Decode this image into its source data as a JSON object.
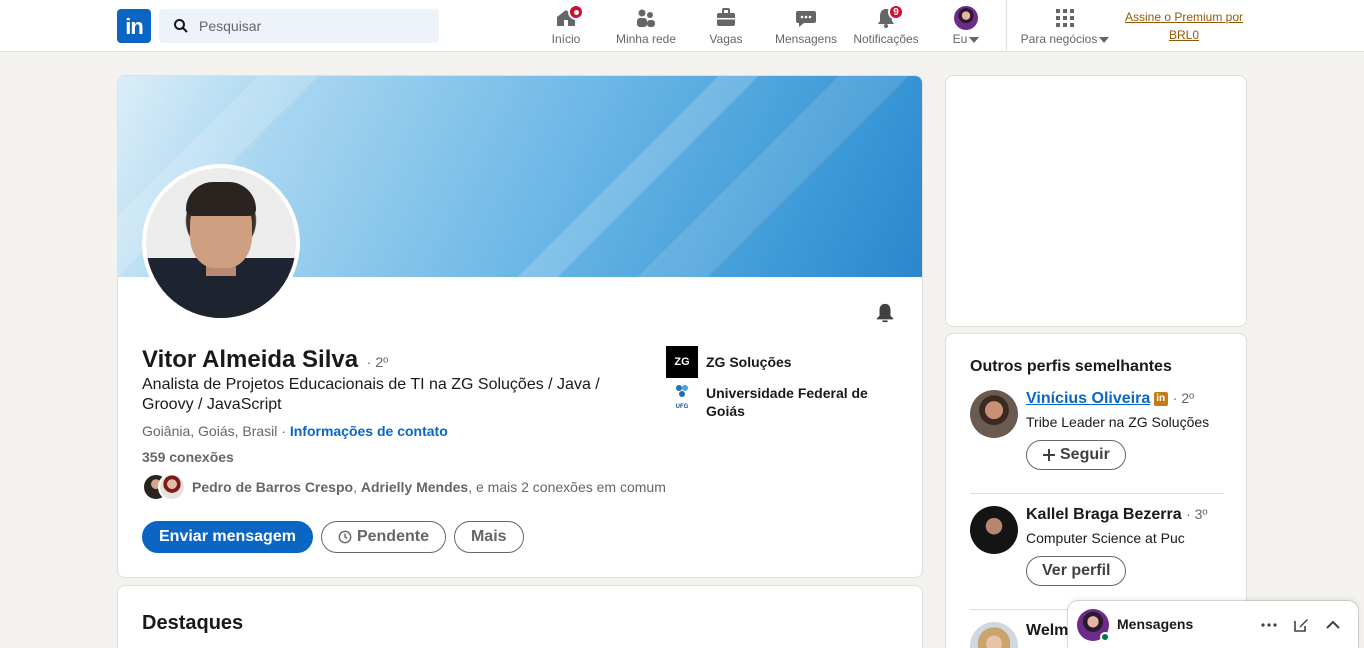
{
  "nav": {
    "search_placeholder": "Pesquisar",
    "items": [
      {
        "label": "Início",
        "icon": "home-icon",
        "badge": "dot"
      },
      {
        "label": "Minha rede",
        "icon": "network-icon"
      },
      {
        "label": "Vagas",
        "icon": "briefcase-icon"
      },
      {
        "label": "Mensagens",
        "icon": "messaging-icon"
      },
      {
        "label": "Notificações",
        "icon": "bell-icon",
        "badge": "9"
      },
      {
        "label": "Eu",
        "icon": "avatar"
      },
      {
        "label": "Para negócios",
        "icon": "grid-icon"
      }
    ],
    "premium": "Assine o Premium por BRL0"
  },
  "profile": {
    "name": "Vitor Almeida Silva",
    "degree": "· 2º",
    "headline": "Analista de Projetos Educacionais de TI na ZG Soluções / Java / Groovy / JavaScript",
    "location": "Goiânia, Goiás, Brasil ·",
    "contact_link": "Informações de contato",
    "connections": "359 conexões",
    "mutual_names": [
      "Pedro de Barros Crespo",
      "Adrielly Mendes"
    ],
    "mutual_sep": ",",
    "mutual_rest": ", e mais 2 conexões em comum",
    "buttons": {
      "message": "Enviar mensagem",
      "pending": "Pendente",
      "more": "Mais"
    },
    "orgs": [
      {
        "name": "ZG Soluções",
        "logo_text": "ZG"
      },
      {
        "name": "Universidade Federal de Goiás",
        "logo_text": "UFG"
      }
    ]
  },
  "highlights": {
    "title": "Destaques"
  },
  "similar": {
    "title": "Outros perfis semelhantes",
    "people": [
      {
        "name": "Vinícius Oliveira",
        "degree": "· 2º",
        "headline": "Tribe Leader na ZG Soluções",
        "action": "Seguir"
      },
      {
        "name": "Kallel Braga Bezerra",
        "degree": "· 3º",
        "headline": "Computer Science at Puc",
        "action": "Ver perfil"
      },
      {
        "name": "Welma"
      }
    ]
  },
  "messaging": {
    "title": "Mensagens"
  },
  "colors": {
    "brand": "#0a66c2",
    "badge": "#cb112d",
    "premium": "#915907"
  }
}
